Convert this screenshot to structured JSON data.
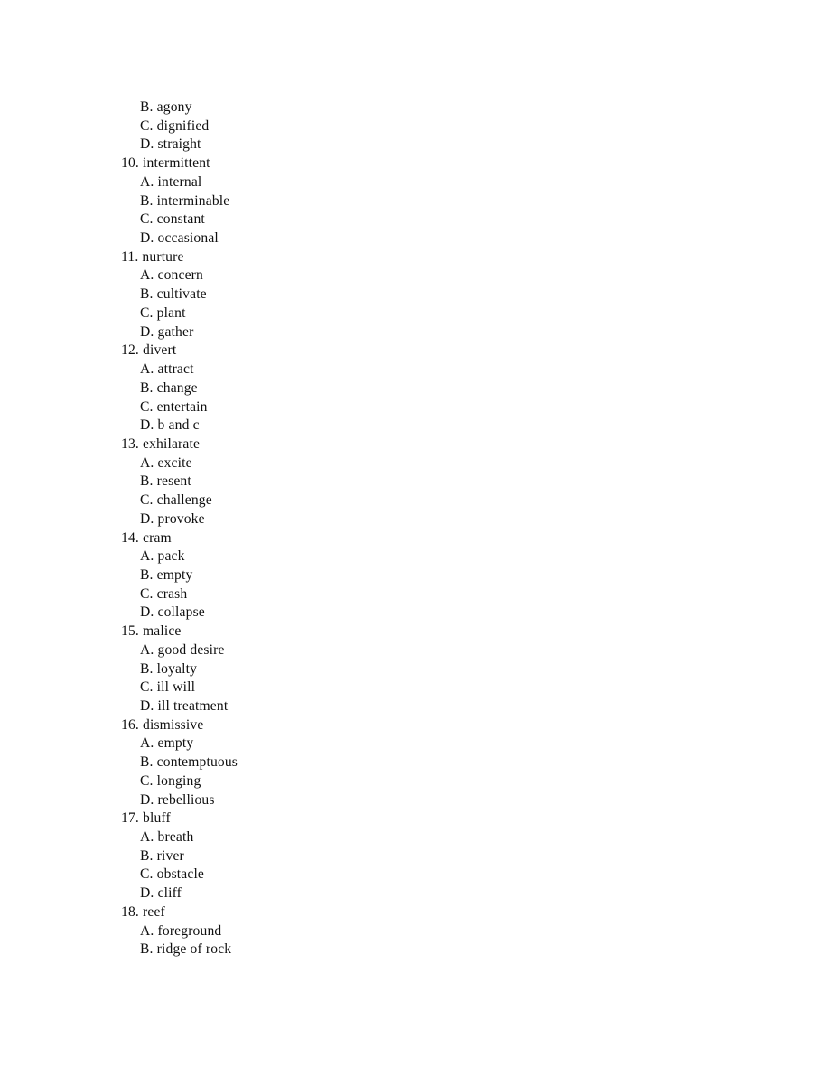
{
  "document": {
    "type": "vocabulary multiple choice worksheet",
    "page_background": "#ffffff",
    "text_color": "#101010"
  },
  "orphan_options": [
    {
      "label": "B. agony"
    },
    {
      "label": "C. dignified"
    },
    {
      "label": "D. straight"
    }
  ],
  "questions": [
    {
      "stem": "10. intermittent",
      "options": [
        "A. internal",
        "B. interminable",
        "C. constant",
        "D. occasional"
      ]
    },
    {
      "stem": "11. nurture",
      "options": [
        "A. concern",
        "B. cultivate",
        "C. plant",
        "D. gather"
      ]
    },
    {
      "stem": "12. divert",
      "options": [
        "A. attract",
        "B. change",
        "C. entertain",
        "D. b and c"
      ]
    },
    {
      "stem": "13. exhilarate",
      "options": [
        "A. excite",
        "B. resent",
        "C. challenge",
        "D. provoke"
      ]
    },
    {
      "stem": "14. cram",
      "options": [
        "A. pack",
        "B. empty",
        "C. crash",
        "D. collapse"
      ]
    },
    {
      "stem": "15. malice",
      "options": [
        "A. good desire",
        "B. loyalty",
        "C. ill will",
        "D. ill treatment"
      ]
    },
    {
      "stem": "16. dismissive",
      "options": [
        "A. empty",
        "B. contemptuous",
        "C. longing",
        "D. rebellious"
      ]
    },
    {
      "stem": "17. bluff",
      "options": [
        "A. breath",
        "B. river",
        "C. obstacle",
        "D. cliff"
      ]
    },
    {
      "stem": "18. reef",
      "options": [
        "A. foreground",
        "B. ridge of rock"
      ]
    }
  ]
}
